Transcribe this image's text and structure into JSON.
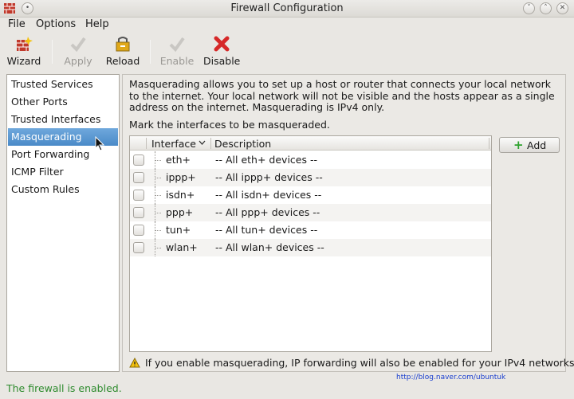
{
  "window": {
    "title": "Firewall Configuration"
  },
  "menu": {
    "file": "File",
    "options": "Options",
    "help": "Help"
  },
  "toolbar": {
    "wizard": "Wizard",
    "apply": "Apply",
    "reload": "Reload",
    "enable": "Enable",
    "disable": "Disable"
  },
  "sidebar": {
    "items": [
      {
        "label": "Trusted Services"
      },
      {
        "label": "Other Ports"
      },
      {
        "label": "Trusted Interfaces"
      },
      {
        "label": "Masquerading"
      },
      {
        "label": "Port Forwarding"
      },
      {
        "label": "ICMP Filter"
      },
      {
        "label": "Custom Rules"
      }
    ],
    "selected": "Masquerading"
  },
  "content": {
    "description": "Masquerading allows you to set up a host or router that connects your local network to the internet. Your local network will not be visible and the hosts appear as a single address on the internet. Masquerading is IPv4 only.",
    "mark_label": "Mark the interfaces to be masqueraded.",
    "columns": {
      "interface": "Interface",
      "description": "Description"
    },
    "rows": [
      {
        "interface": "eth+",
        "description": "-- All eth+ devices --",
        "checked": false
      },
      {
        "interface": "ippp+",
        "description": "-- All ippp+ devices --",
        "checked": false
      },
      {
        "interface": "isdn+",
        "description": "-- All isdn+ devices --",
        "checked": false
      },
      {
        "interface": "ppp+",
        "description": "-- All ppp+ devices --",
        "checked": false
      },
      {
        "interface": "tun+",
        "description": "-- All tun+ devices --",
        "checked": false
      },
      {
        "interface": "wlan+",
        "description": "-- All wlan+ devices --",
        "checked": false
      }
    ],
    "add_button": "Add",
    "warning": "If you enable masquerading, IP forwarding will also be enabled for your IPv4 networks.",
    "watermark": "http://blog.naver.com/ubuntuk"
  },
  "status": {
    "text": "The firewall is enabled.",
    "color": "#2e8b2e"
  },
  "colors": {
    "selection": "#4a8ac8",
    "window_bg": "#e9e7e3"
  }
}
